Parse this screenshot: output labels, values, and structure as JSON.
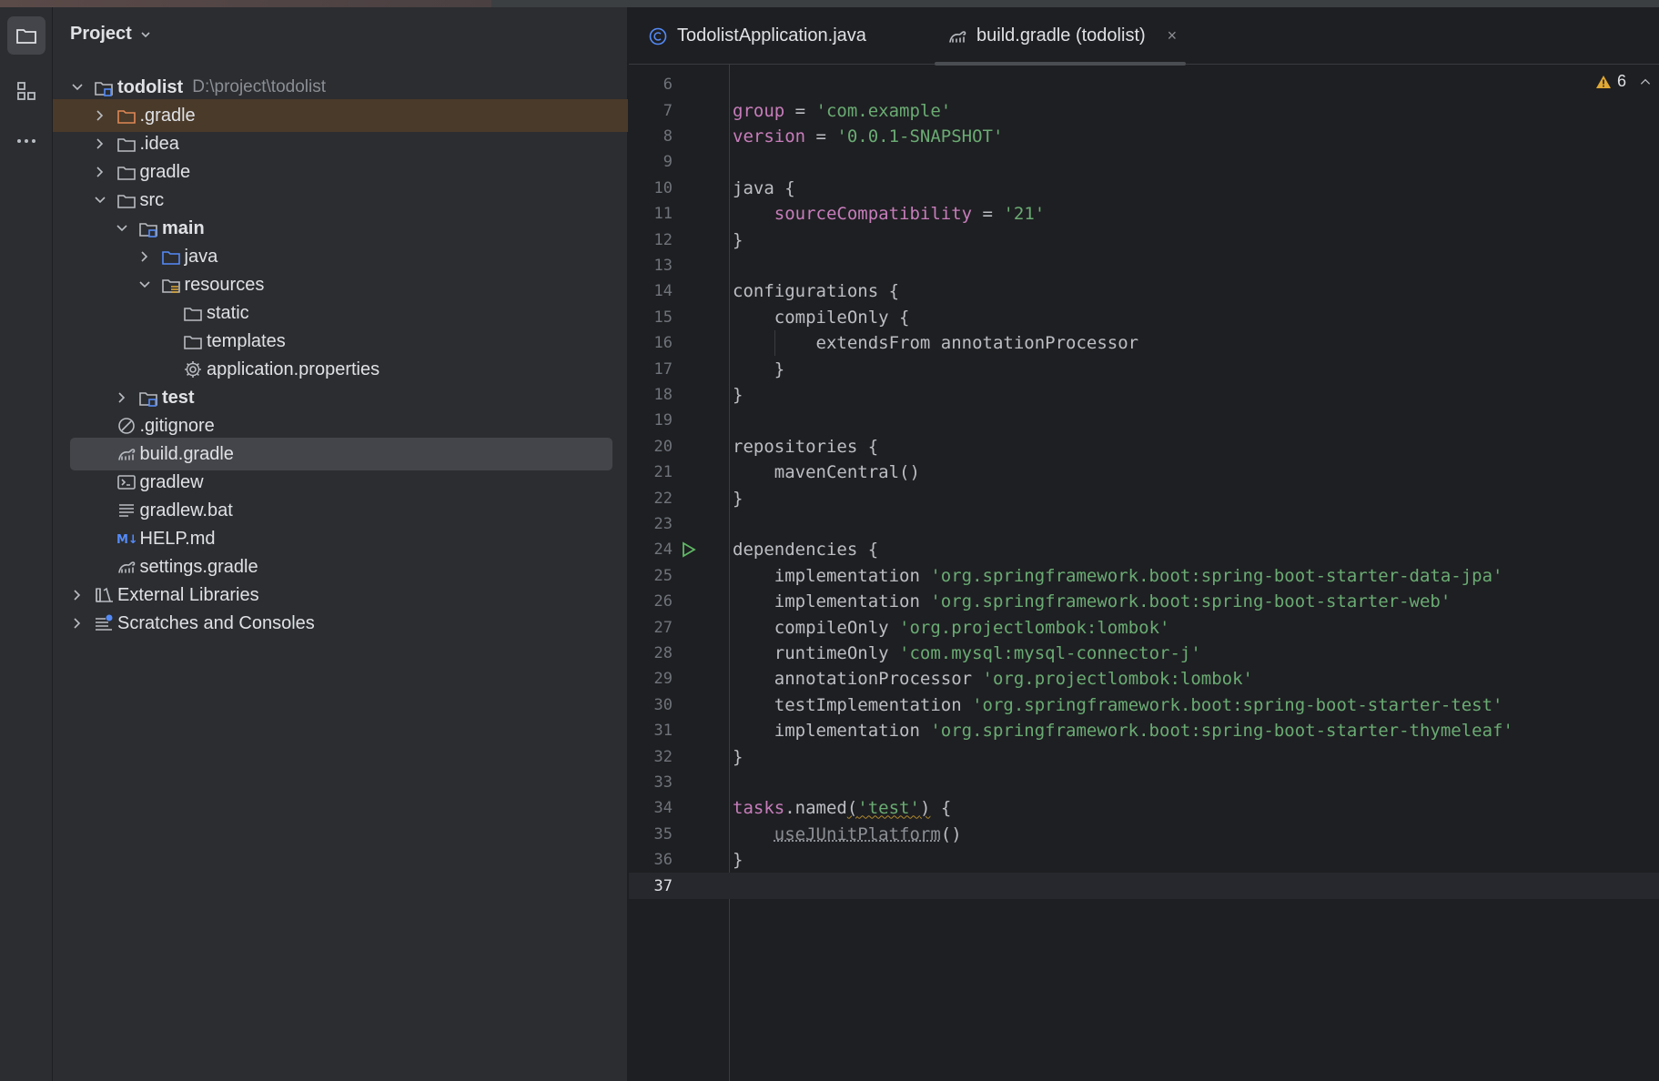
{
  "colors": {
    "background": "#1e1f22",
    "panel": "#2b2d30",
    "selection": "#43454a",
    "highlight_row": "#4a3a2a",
    "keyword": "#c77dbb",
    "string": "#6aab73",
    "folder_blue": "#548af7",
    "warning": "#e0a835"
  },
  "project_panel": {
    "title": "Project",
    "tree": [
      {
        "label": "todolist",
        "path": "D:\\project\\todolist",
        "icon": "module-folder-icon",
        "depth": 0,
        "expanded": true,
        "bold": true
      },
      {
        "label": ".gradle",
        "icon": "folder-excluded-icon",
        "depth": 1,
        "expanded": false,
        "state": "highlighted"
      },
      {
        "label": ".idea",
        "icon": "folder-icon",
        "depth": 1,
        "expanded": false
      },
      {
        "label": "gradle",
        "icon": "folder-icon",
        "depth": 1,
        "expanded": false
      },
      {
        "label": "src",
        "icon": "folder-icon",
        "depth": 1,
        "expanded": true
      },
      {
        "label": "main",
        "icon": "module-folder-icon",
        "depth": 2,
        "expanded": true,
        "bold": true
      },
      {
        "label": "java",
        "icon": "source-folder-icon",
        "depth": 3,
        "expanded": false
      },
      {
        "label": "resources",
        "icon": "resources-folder-icon",
        "depth": 3,
        "expanded": true
      },
      {
        "label": "static",
        "icon": "folder-icon",
        "depth": 4
      },
      {
        "label": "templates",
        "icon": "folder-icon",
        "depth": 4
      },
      {
        "label": "application.properties",
        "icon": "gear-icon",
        "depth": 4
      },
      {
        "label": "test",
        "icon": "module-folder-icon",
        "depth": 2,
        "expanded": false,
        "bold": true
      },
      {
        "label": ".gitignore",
        "icon": "ignore-icon",
        "depth": 1
      },
      {
        "label": "build.gradle",
        "icon": "gradle-icon",
        "depth": 1,
        "state": "selected"
      },
      {
        "label": "gradlew",
        "icon": "terminal-icon",
        "depth": 1
      },
      {
        "label": "gradlew.bat",
        "icon": "text-file-icon",
        "depth": 1
      },
      {
        "label": "HELP.md",
        "icon": "markdown-icon",
        "depth": 1
      },
      {
        "label": "settings.gradle",
        "icon": "gradle-icon",
        "depth": 1
      },
      {
        "label": "External Libraries",
        "icon": "libraries-icon",
        "depth": 0,
        "expanded": false
      },
      {
        "label": "Scratches and Consoles",
        "icon": "scratches-icon",
        "depth": 0,
        "expanded": false
      }
    ]
  },
  "editor": {
    "tabs": [
      {
        "label": "TodolistApplication.java",
        "icon": "java-class-icon",
        "active": false
      },
      {
        "label": "build.gradle (todolist)",
        "icon": "gradle-icon",
        "active": true,
        "close": "×"
      }
    ],
    "warnings_count": "6",
    "current_line": "37",
    "lines": [
      {
        "n": "6",
        "tokens": []
      },
      {
        "n": "7",
        "tokens": [
          {
            "t": "group",
            "c": "prop"
          },
          {
            "t": " = "
          },
          {
            "t": "'com.example'",
            "c": "str"
          }
        ]
      },
      {
        "n": "8",
        "tokens": [
          {
            "t": "version",
            "c": "prop"
          },
          {
            "t": " = "
          },
          {
            "t": "'0.0.1-SNAPSHOT'",
            "c": "str"
          }
        ]
      },
      {
        "n": "9",
        "tokens": []
      },
      {
        "n": "10",
        "tokens": [
          {
            "t": "java {"
          }
        ]
      },
      {
        "n": "11",
        "tokens": [
          {
            "t": "    "
          },
          {
            "t": "sourceCompatibility",
            "c": "prop"
          },
          {
            "t": " = "
          },
          {
            "t": "'21'",
            "c": "str"
          }
        ]
      },
      {
        "n": "12",
        "tokens": [
          {
            "t": "}"
          }
        ]
      },
      {
        "n": "13",
        "tokens": []
      },
      {
        "n": "14",
        "tokens": [
          {
            "t": "configurations {"
          }
        ]
      },
      {
        "n": "15",
        "tokens": [
          {
            "t": "    compileOnly {"
          }
        ]
      },
      {
        "n": "16",
        "tokens": [
          {
            "t": "        extendsFrom annotationProcessor"
          }
        ]
      },
      {
        "n": "17",
        "tokens": [
          {
            "t": "    }"
          }
        ]
      },
      {
        "n": "18",
        "tokens": [
          {
            "t": "}"
          }
        ]
      },
      {
        "n": "19",
        "tokens": []
      },
      {
        "n": "20",
        "tokens": [
          {
            "t": "repositories {"
          }
        ]
      },
      {
        "n": "21",
        "tokens": [
          {
            "t": "    mavenCentral()"
          }
        ]
      },
      {
        "n": "22",
        "tokens": [
          {
            "t": "}"
          }
        ]
      },
      {
        "n": "23",
        "tokens": []
      },
      {
        "n": "24",
        "tokens": [
          {
            "t": "dependencies {"
          }
        ],
        "run": true
      },
      {
        "n": "25",
        "tokens": [
          {
            "t": "    implementation "
          },
          {
            "t": "'org.springframework.boot:spring-boot-starter-data-jpa'",
            "c": "str"
          }
        ]
      },
      {
        "n": "26",
        "tokens": [
          {
            "t": "    implementation "
          },
          {
            "t": "'org.springframework.boot:spring-boot-starter-web'",
            "c": "str"
          }
        ]
      },
      {
        "n": "27",
        "tokens": [
          {
            "t": "    compileOnly "
          },
          {
            "t": "'org.projectlombok:lombok'",
            "c": "str"
          }
        ]
      },
      {
        "n": "28",
        "tokens": [
          {
            "t": "    runtimeOnly "
          },
          {
            "t": "'com.mysql:mysql-connector-j'",
            "c": "str"
          }
        ]
      },
      {
        "n": "29",
        "tokens": [
          {
            "t": "    annotationProcessor "
          },
          {
            "t": "'org.projectlombok:lombok'",
            "c": "str"
          }
        ]
      },
      {
        "n": "30",
        "tokens": [
          {
            "t": "    testImplementation "
          },
          {
            "t": "'org.springframework.boot:spring-boot-starter-test'",
            "c": "str"
          }
        ]
      },
      {
        "n": "31",
        "tokens": [
          {
            "t": "    implementation "
          },
          {
            "t": "'org.springframework.boot:spring-boot-starter-thymeleaf'",
            "c": "str"
          }
        ]
      },
      {
        "n": "32",
        "tokens": [
          {
            "t": "}"
          }
        ]
      },
      {
        "n": "33",
        "tokens": []
      },
      {
        "n": "34",
        "tokens": [
          {
            "t": "tasks",
            "c": "kw"
          },
          {
            "t": ".named"
          },
          {
            "t": "(",
            "c": "warn"
          },
          {
            "t": "'test'",
            "c": "str warn"
          },
          {
            "t": ")",
            "c": "warn"
          },
          {
            "t": " {"
          }
        ]
      },
      {
        "n": "35",
        "tokens": [
          {
            "t": "    "
          },
          {
            "t": "useJUnitPlatform",
            "c": "dep"
          },
          {
            "t": "()"
          }
        ]
      },
      {
        "n": "36",
        "tokens": [
          {
            "t": "}"
          }
        ]
      },
      {
        "n": "37",
        "tokens": []
      }
    ]
  }
}
